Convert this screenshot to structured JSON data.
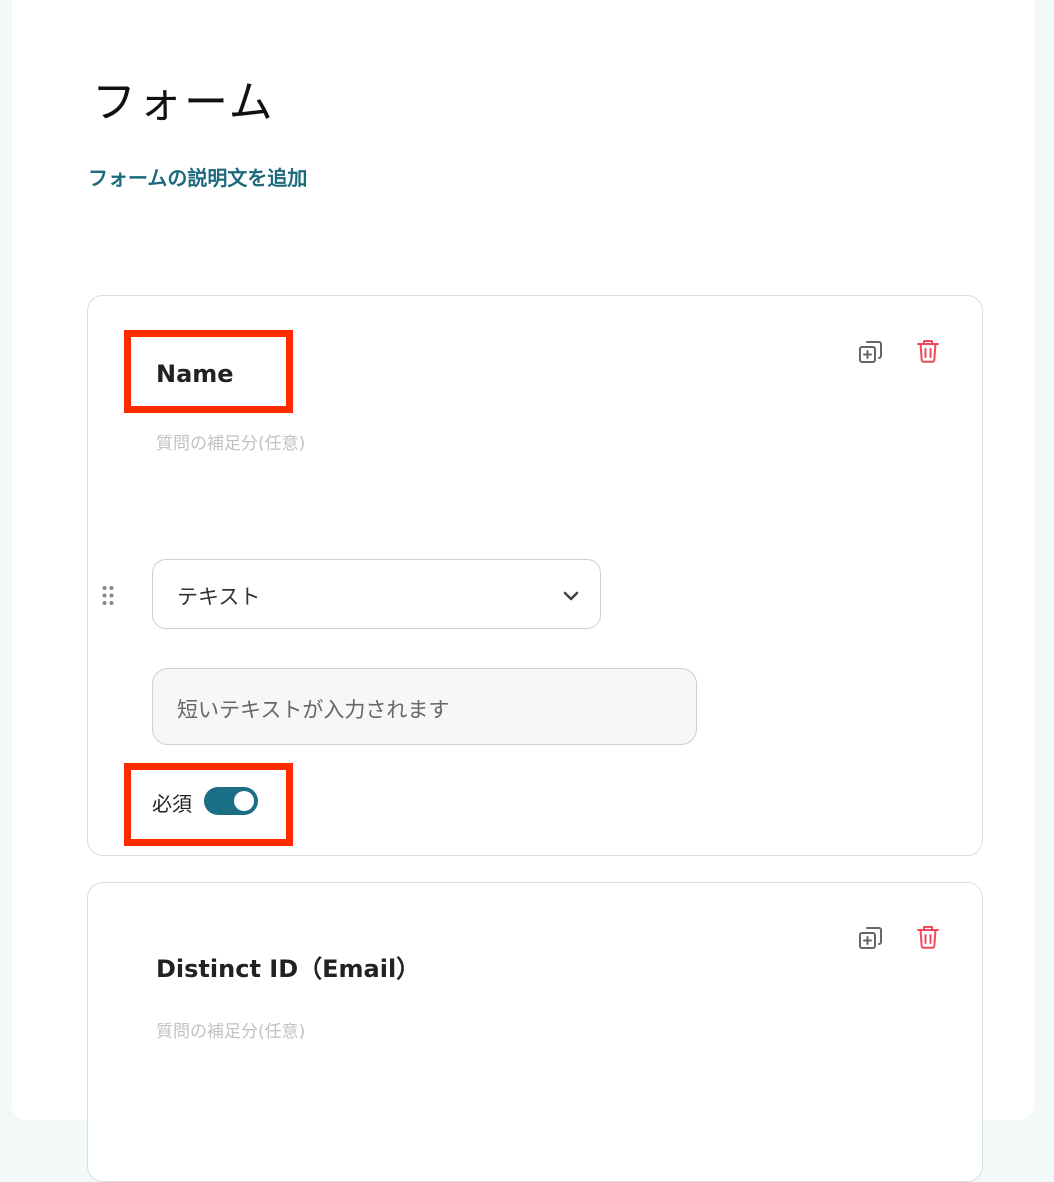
{
  "form": {
    "title": "フォーム",
    "add_description_link": "フォームの説明文を追加"
  },
  "questions": [
    {
      "title": "Name",
      "subtitle_placeholder": "質問の補足分(任意)",
      "type_select": {
        "value": "テキスト",
        "icon": "chevron-down-icon"
      },
      "preview_placeholder": "短いテキストが入力されます",
      "required_label": "必須",
      "required": true,
      "icons": [
        "duplicate-icon",
        "trash-icon",
        "drag-handle-icon"
      ]
    },
    {
      "title": "Distinct ID（Email）",
      "subtitle_placeholder": "質問の補足分(任意)",
      "icons": [
        "duplicate-icon",
        "trash-icon"
      ]
    }
  ],
  "colors": {
    "link": "#1e6a7d",
    "toggle_on": "#1a6f86",
    "delete_icon": "#f04a5a",
    "highlight": "#ff2a00"
  }
}
